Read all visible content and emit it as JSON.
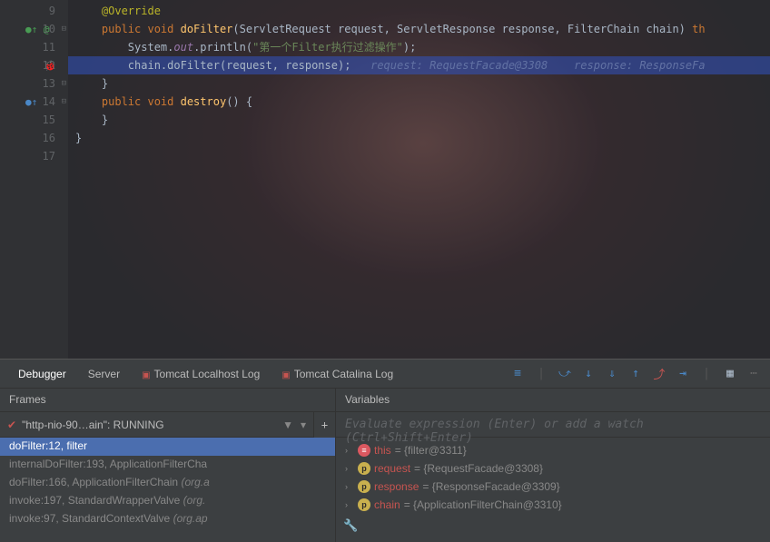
{
  "lines": [
    {
      "num": "9",
      "icon": "",
      "fold": ""
    },
    {
      "num": "10",
      "icon": "●↑ @",
      "fold": "⊟"
    },
    {
      "num": "11",
      "icon": "",
      "fold": ""
    },
    {
      "num": "12",
      "icon": "🐞",
      "fold": ""
    },
    {
      "num": "13",
      "icon": "",
      "fold": "⊟"
    },
    {
      "num": "14",
      "icon": "●↑",
      "fold": "⊟"
    },
    {
      "num": "15",
      "icon": "",
      "fold": ""
    },
    {
      "num": "16",
      "icon": "",
      "fold": ""
    },
    {
      "num": "17",
      "icon": "",
      "fold": ""
    }
  ],
  "code": {
    "l9": "@Override",
    "l10": {
      "kw1": "public void ",
      "m": "doFilter",
      "p": "(ServletRequest request, ServletResponse response, FilterChain chain) ",
      "kw2": "th"
    },
    "l11": {
      "a": "System.",
      "b": "out",
      "c": ".println(",
      "d": "\"第一个Filter执行过滤操作\"",
      "e": ");"
    },
    "l12": {
      "a": "chain.doFilter(request, response);",
      "h": "   request: RequestFacade@3308    response: ResponseFa"
    },
    "l13": "}",
    "l14": {
      "kw1": "public void ",
      "m": "destroy",
      "p": "() {"
    },
    "l15": "}",
    "l16": "}"
  },
  "tabs": {
    "debugger": "Debugger",
    "server": "Server",
    "localhost": "Tomcat Localhost Log",
    "catalina": "Tomcat Catalina Log"
  },
  "panels": {
    "frames_header": "Frames",
    "vars_header": "Variables",
    "thread": "\"http-nio-90…ain\": RUNNING",
    "watch_placeholder": "Evaluate expression (Enter) or add a watch (Ctrl+Shift+Enter)"
  },
  "frames": [
    {
      "text": "doFilter:12, filter",
      "sel": true
    },
    {
      "text": "internalDoFilter:193, ApplicationFilterCha"
    },
    {
      "text": "doFilter:166, ApplicationFilterChain",
      "loc": " (org.a"
    },
    {
      "text": "invoke:197, StandardWrapperValve",
      "loc": " (org."
    },
    {
      "text": "invoke:97, StandardContextValve",
      "loc": " (org.ap"
    }
  ],
  "vars": [
    {
      "badge": "red",
      "badgeText": "≡",
      "name": "this",
      "val": " = {filter@3311}"
    },
    {
      "badge": "p",
      "badgeText": "p",
      "name": "request",
      "val": " = {RequestFacade@3308}"
    },
    {
      "badge": "p",
      "badgeText": "p",
      "name": "response",
      "val": " = {ResponseFacade@3309}"
    },
    {
      "badge": "p",
      "badgeText": "p",
      "name": "chain",
      "val": " = {ApplicationFilterChain@3310}"
    }
  ]
}
